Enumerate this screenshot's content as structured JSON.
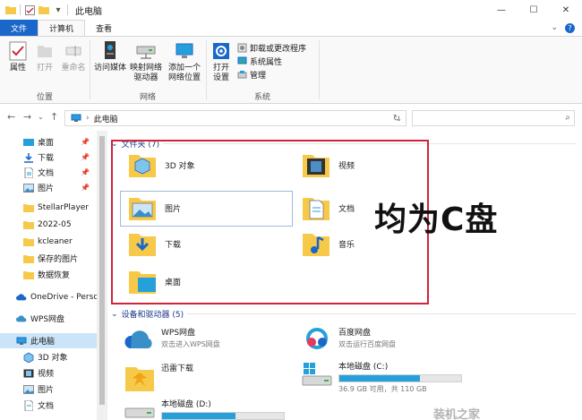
{
  "window": {
    "title": "此电脑",
    "controls": {
      "minimize": "—",
      "maximize": "☐",
      "close": "✕"
    }
  },
  "ribbon_tabs": {
    "file": "文件",
    "computer": "计算机",
    "view": "查看"
  },
  "ribbon": {
    "location": {
      "label": "位置",
      "properties": "属性",
      "open": "打开",
      "rename": "重命名"
    },
    "network": {
      "label": "网络",
      "access_media": "访问媒体",
      "map_drive_1": "映射网络",
      "map_drive_2": "驱动器",
      "add_location_1": "添加一个",
      "add_location_2": "网络位置"
    },
    "system": {
      "label": "系统",
      "open_settings_1": "打开",
      "open_settings_2": "设置",
      "uninstall": "卸载或更改程序",
      "system_properties": "系统属性",
      "manage": "管理"
    }
  },
  "address": {
    "location": "此电脑"
  },
  "sidebar": {
    "items": [
      {
        "label": "桌面",
        "pinned": true
      },
      {
        "label": "下载",
        "pinned": true
      },
      {
        "label": "文档",
        "pinned": true
      },
      {
        "label": "图片",
        "pinned": true
      },
      {
        "label": "StellarPlayer"
      },
      {
        "label": "2022-05"
      },
      {
        "label": "kcleaner"
      },
      {
        "label": "保存的图片"
      },
      {
        "label": "数据恢复"
      },
      {
        "label": "OneDrive - Perso"
      },
      {
        "label": "WPS网盘"
      },
      {
        "label": "此电脑"
      },
      {
        "label": "3D 对象"
      },
      {
        "label": "视频"
      },
      {
        "label": "图片"
      },
      {
        "label": "文档"
      }
    ]
  },
  "folders_section": {
    "header": "文件夹 (7)",
    "items": [
      "3D 对象",
      "视频",
      "图片",
      "文档",
      "下载",
      "音乐",
      "桌面"
    ]
  },
  "devices_section": {
    "header": "设备和驱动器 (5)",
    "items": [
      {
        "name": "WPS网盘",
        "sub": "双击进入WPS网盘"
      },
      {
        "name": "百度网盘",
        "sub": "双击运行百度网盘"
      },
      {
        "name": "迅雷下载",
        "sub": ""
      },
      {
        "name": "本地磁盘 (C:)",
        "sub": "36.9 GB 可用，共 110 GB",
        "used": 0.66
      },
      {
        "name": "本地磁盘 (D:)",
        "sub": "",
        "used": 0.6
      }
    ]
  },
  "annotation": "均为C盘",
  "watermark": "装机之家",
  "colors": {
    "accent": "#1a67c9",
    "highlight_box": "#d1243a",
    "drive_bar": "#26a0da",
    "folder": "#f7c948"
  }
}
